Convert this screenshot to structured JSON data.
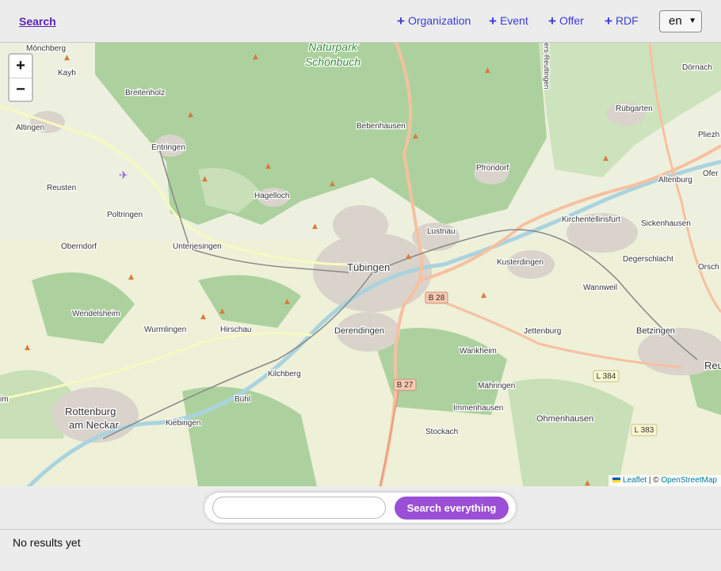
{
  "header": {
    "brand_link": "Search",
    "nav": [
      {
        "label": "Organization"
      },
      {
        "label": "Event"
      },
      {
        "label": "Offer"
      },
      {
        "label": "RDF"
      }
    ],
    "language": "en"
  },
  "map": {
    "zoom_in": "+",
    "zoom_out": "−",
    "labels": {
      "naturpark": "Naturpark",
      "schoenbuch": "Schönbuch",
      "moenchberg": "Mönchberg",
      "kayh": "Kayh",
      "breitenholz": "Breitenholz",
      "altingen": "Altingen",
      "entringen": "Entringen",
      "reusten": "Reusten",
      "poltringen": "Poltringen",
      "oberndorf": "Oberndorf",
      "unterjesingen": "Unterjesingen",
      "hagelloch": "Hagelloch",
      "bebenhausen": "Bebenhausen",
      "pfrondorf": "Pfrondorf",
      "lustnau": "Lustnau",
      "tuebingen": "Tübingen",
      "kusterdingen": "Kusterdingen",
      "kirchentellinsfurt": "Kirchentellinsfurt",
      "sickenhausen": "Sickenhausen",
      "degerschlacht": "Degerschlacht",
      "wannweil": "Wannweil",
      "wendelsheim": "Wendelsheim",
      "wurmlingen": "Wurmlingen",
      "hirschau": "Hirschau",
      "derendingen": "Derendingen",
      "wankheim": "Wankheim",
      "jettenburg": "Jettenburg",
      "betzingen": "Betzingen",
      "kilchberg": "Kilchberg",
      "buehl": "Bühl",
      "maehringen": "Mähringen",
      "immenhausen": "Immenhausen",
      "ohmenhausen": "Ohmenhausen",
      "rottenburg": "Rottenburg",
      "am_neckar": "am Neckar",
      "kiebingen": "Kiebingen",
      "stockach": "Stockach",
      "doernach": "Dörnach",
      "ruebgarten": "Rübgarten",
      "altenburg": "Altenburg",
      "pliezh": "Pliezh",
      "ofer": "Ofer",
      "orsch": "Orsch",
      "reu": "Reu",
      "im": "im",
      "reutlingen_str": "ers-Reutlingen",
      "b28": "B 28",
      "b27": "B 27",
      "l384": "L 384",
      "l383": "L 383"
    },
    "attribution": {
      "leaflet": "Leaflet",
      "separator": " | © ",
      "osm": "OpenStreetMap"
    }
  },
  "search": {
    "placeholder": "",
    "button_label": "Search everything"
  },
  "results": {
    "status": "No results yet"
  },
  "colors": {
    "brand": "#5b21b6",
    "nav_link": "#3b3bd6",
    "search_button": "#9a4fd6",
    "forest": "#add19e",
    "town": "#d9d3cc",
    "water": "#aad3df"
  }
}
